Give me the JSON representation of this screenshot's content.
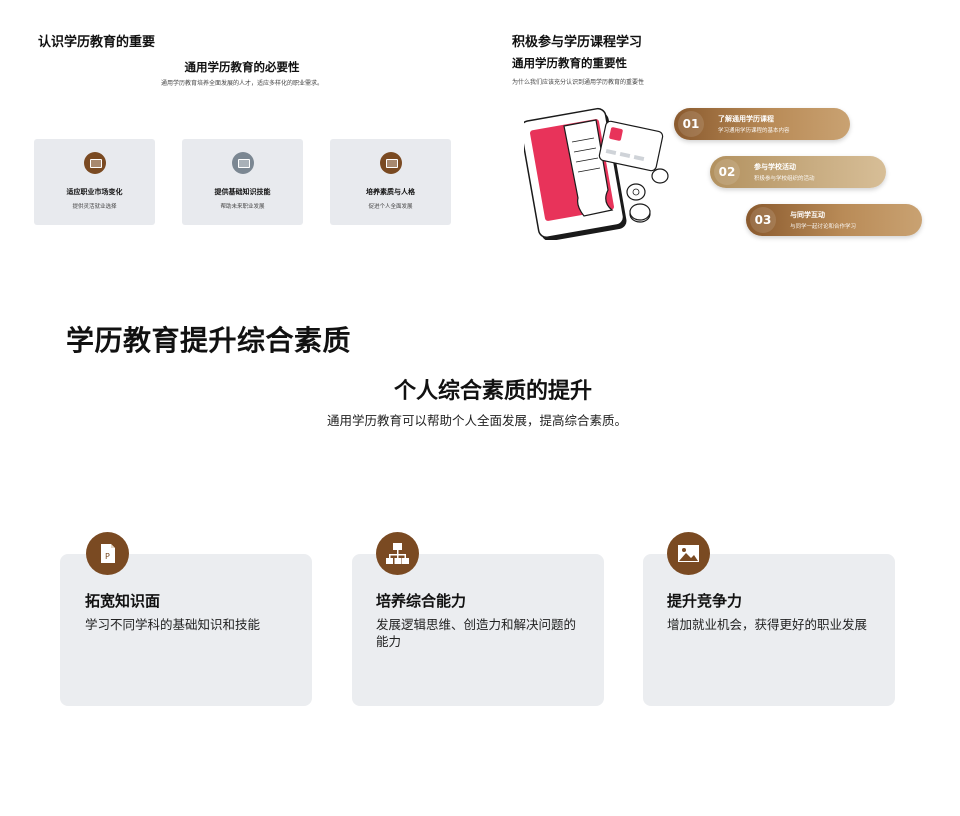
{
  "slide1": {
    "title": "认识学历教育的重要",
    "subtitle": "通用学历教育的必要性",
    "description": "通用学历教育培养全面发展的人才，适应多样化的职业需求。",
    "cards": [
      {
        "title": "适应职业市场变化",
        "desc": "提供灵活就业选择",
        "icon": "briefcase-icon"
      },
      {
        "title": "提供基础知识技能",
        "desc": "帮助未来职业发展",
        "icon": "briefcase-icon"
      },
      {
        "title": "培养素质与人格",
        "desc": "促进个人全面发展",
        "icon": "briefcase-icon"
      }
    ]
  },
  "slide2": {
    "title": "积极参与学历课程学习",
    "subtitle": "通用学历教育的重要性",
    "description": "为什么我们应该充分认识到通用学历教育的重要性",
    "steps": [
      {
        "num": "01",
        "title": "了解通用学历课程",
        "desc": "学习通用学历课程的基本内容"
      },
      {
        "num": "02",
        "title": "参与学校活动",
        "desc": "积极参与学校组织的活动"
      },
      {
        "num": "03",
        "title": "与同学互动",
        "desc": "与同学一起讨论和合作学习"
      }
    ]
  },
  "slide3": {
    "title": "学历教育提升综合素质",
    "subtitle": "个人综合素质的提升",
    "description": "通用学历教育可以帮助个人全面发展，提高综合素质。",
    "cards": [
      {
        "title": "拓宽知识面",
        "desc": "学习不同学科的基础知识和技能",
        "icon": "document-p-icon"
      },
      {
        "title": "培养综合能力",
        "desc": "发展逻辑思维、创造力和解决问题的能力",
        "icon": "hierarchy-icon"
      },
      {
        "title": "提升竞争力",
        "desc": "增加就业机会，获得更好的职业发展",
        "icon": "image-icon"
      }
    ]
  },
  "colors": {
    "accent": "#7a4a22",
    "grey_icon": "#7b8792",
    "card_bg": "#ebedf0",
    "phone_red": "#e8335a"
  }
}
